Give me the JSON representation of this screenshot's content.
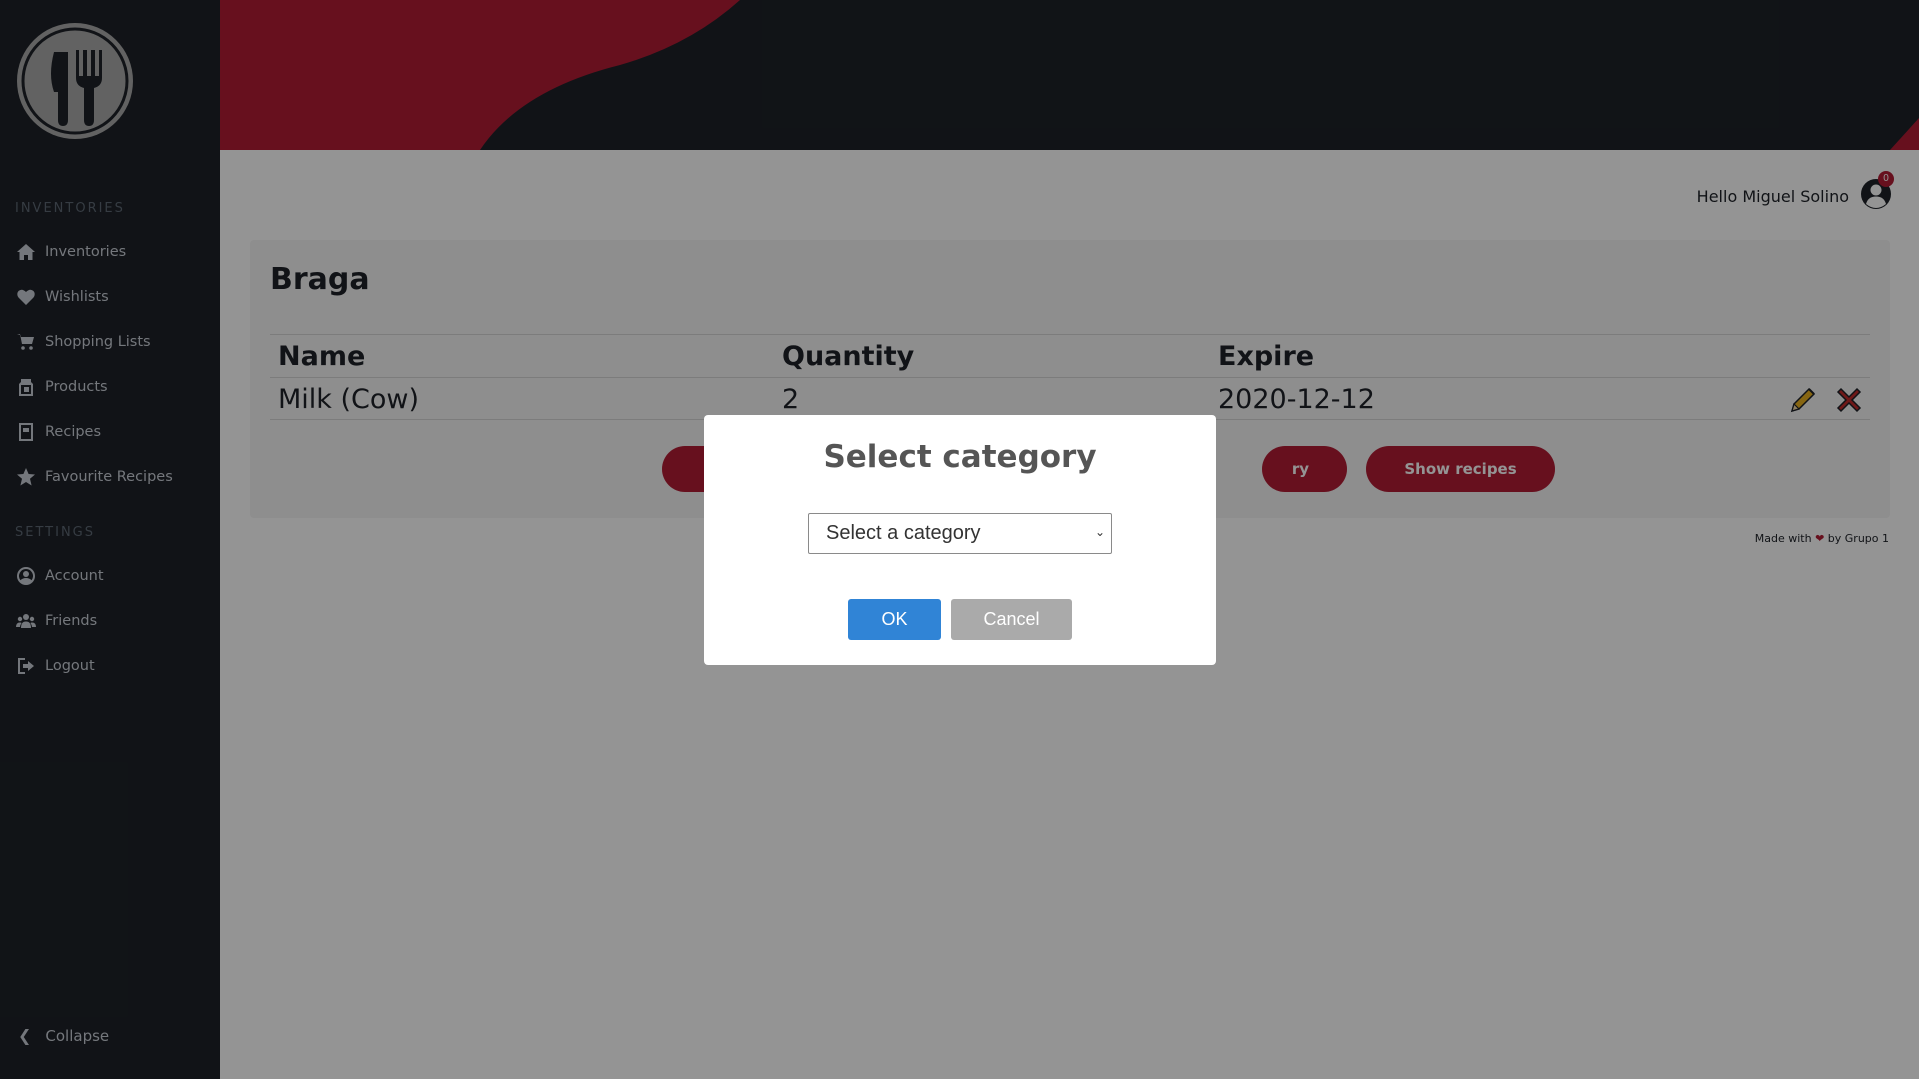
{
  "colors": {
    "sidebar": "#1e2228",
    "accent": "#b11d35",
    "ok_button": "#3084d6",
    "cancel_button": "#aaaaaa"
  },
  "sidebar": {
    "logo_icon": "fork-knife-icon",
    "inventories_section": "INVENTORIES",
    "settings_section": "SETTINGS",
    "items": [
      {
        "label": "Inventories",
        "icon": "home-icon"
      },
      {
        "label": "Wishlists",
        "icon": "heart-icon"
      },
      {
        "label": "Shopping Lists",
        "icon": "cart-icon"
      },
      {
        "label": "Products",
        "icon": "box-icon"
      },
      {
        "label": "Recipes",
        "icon": "book-icon"
      },
      {
        "label": "Favourite Recipes",
        "icon": "star-icon"
      }
    ],
    "settings_items": [
      {
        "label": "Account",
        "icon": "user-icon"
      },
      {
        "label": "Friends",
        "icon": "users-icon"
      },
      {
        "label": "Logout",
        "icon": "logout-icon"
      }
    ],
    "collapse_label": "Collapse"
  },
  "header": {
    "greeting": "Hello Miguel Solino",
    "notification_count": "0"
  },
  "card": {
    "title": "Braga",
    "columns": [
      "Name",
      "Quantity",
      "Expire"
    ],
    "rows": [
      {
        "name": "Milk (Cow)",
        "quantity": "2",
        "expire": "2020-12-12"
      }
    ],
    "button_partial_label": "ry",
    "show_recipes_label": "Show recipes"
  },
  "footer": {
    "made_with": "Made with",
    "by": "by Grupo 1"
  },
  "modal": {
    "title": "Select category",
    "select_value": "Select a category",
    "ok_label": "OK",
    "cancel_label": "Cancel"
  }
}
